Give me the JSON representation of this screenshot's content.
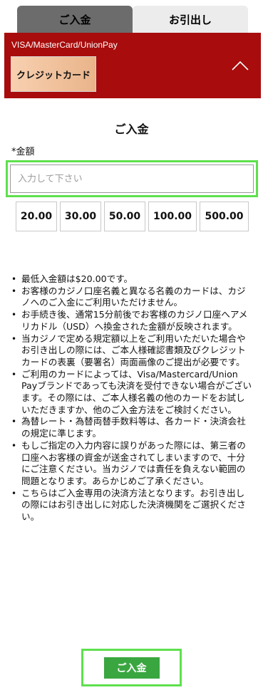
{
  "tabs": [
    {
      "label": "ご入金",
      "active": true
    },
    {
      "label": "お引出し",
      "active": false
    }
  ],
  "method": {
    "title": "VISA/MasterCard/UnionPay",
    "badge": "クレジットカード",
    "icon": "chevron-up-icon",
    "color": "#a80c0c"
  },
  "deposit": {
    "section_title": "ご入金",
    "amount_label": "*金額",
    "amount_placeholder": "入力して下さい",
    "amount_value": "",
    "presets": [
      "20.00",
      "30.00",
      "50.00",
      "100.00",
      "500.00"
    ]
  },
  "notes": [
    "最低入金額は$20.00です。",
    "お客様のカジノ口座名義と異なる名義のカードは、カジノへのご入金にご利用いただけません。",
    "お手続き後、通常15分前後でお客様のカジノ口座へアメリカドル（USD）へ換金された金額が反映されます。",
    "当カジノで定める規定額以上をご利用いただいた場合やお引き出しの際には、ご本人様確認書類及びクレジットカードの表裏（要署名）両面画像のご提出が必要です。",
    "ご利用のカードによっては、Visa/Mastercard/Union Payブランドであっても決済を受付できない場合がございます。その際には、ご本人様名義の他のカードをお試しいただきますか、他のご入金方法をご検討ください。",
    "為替レート・為替両替手数料等は、各カード・決済会社の規定に準じます。",
    "もしご指定の入力内容に誤りがあった際には、第三者の口座へお客様の資金が送金されてしまいますので、十分にご注意ください。当カジノでは責任を負えない範囲の問題となります。あらかじめご了承ください。",
    "こちらはご入金専用の決済方法となります。お引き出しの際にはお引き出しに対応した決済機関をご選択ください。"
  ],
  "submit": {
    "label": "ご入金",
    "color": "#3aa640"
  }
}
